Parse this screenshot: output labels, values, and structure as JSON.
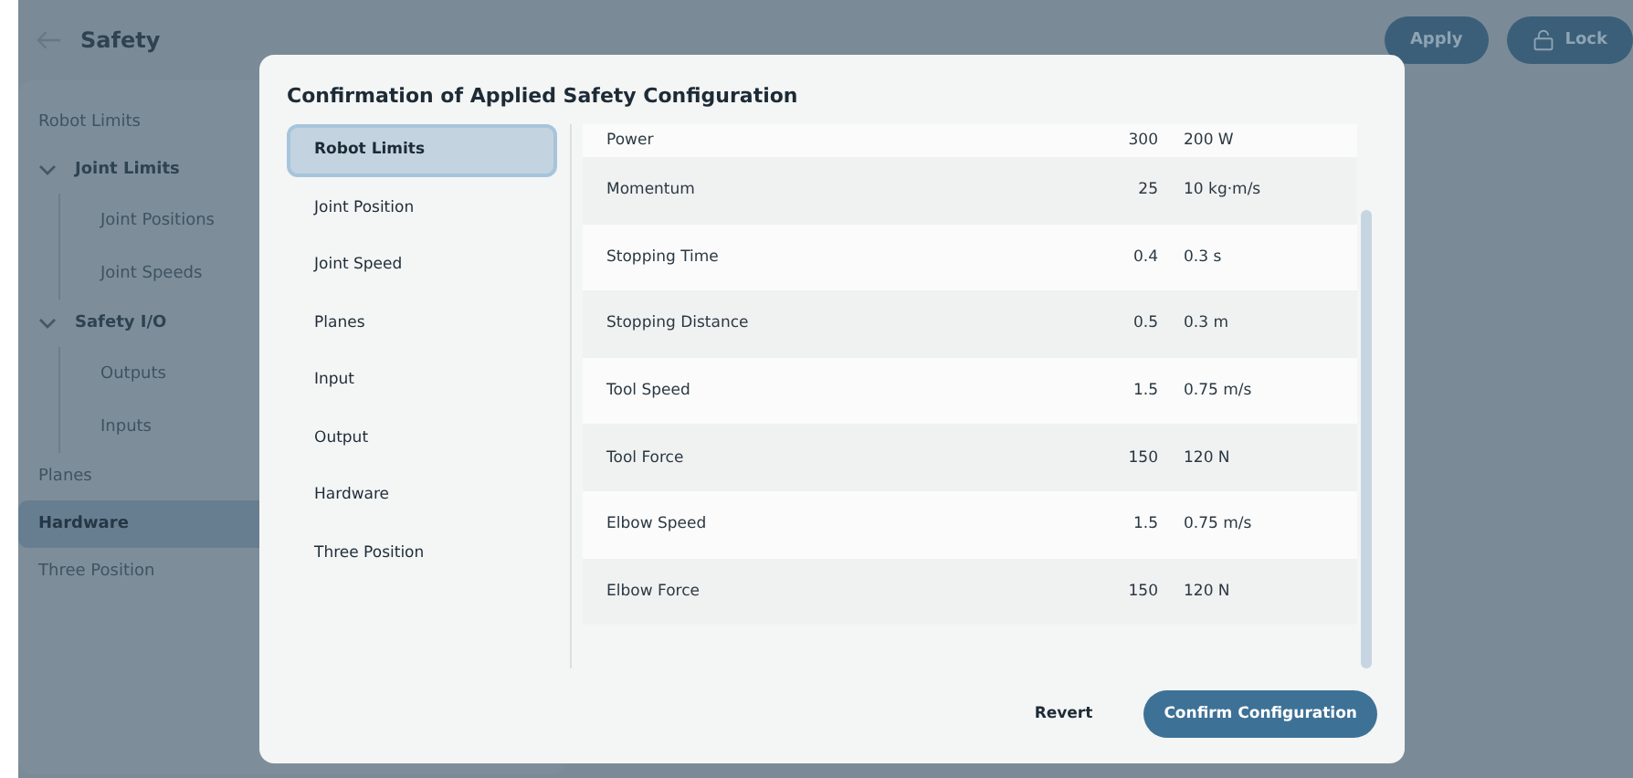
{
  "header": {
    "title": "Safety",
    "buttons": [
      {
        "label": "Apply",
        "kind": "text"
      },
      {
        "label": "Lock",
        "kind": "lock"
      }
    ]
  },
  "sidebar": {
    "items": [
      {
        "label": "Robot Limits",
        "selected": false
      },
      {
        "label": "Joint Limits",
        "selected": false,
        "expanded": true,
        "children": [
          {
            "label": "Joint Positions",
            "selected": false
          },
          {
            "label": "Joint Speeds",
            "selected": false
          }
        ]
      },
      {
        "label": "Safety I/O",
        "selected": false,
        "expanded": true,
        "children": [
          {
            "label": "Outputs",
            "selected": false
          },
          {
            "label": "Inputs",
            "selected": false
          }
        ]
      },
      {
        "label": "Planes",
        "selected": false
      },
      {
        "label": "Hardware",
        "selected": true
      },
      {
        "label": "Three Position",
        "selected": false
      }
    ]
  },
  "dialog": {
    "title": "Confirmation of Applied Safety Configuration",
    "nav": [
      {
        "label": "Robot Limits",
        "selected": true
      },
      {
        "label": "Joint Position",
        "selected": false
      },
      {
        "label": "Joint Speed",
        "selected": false
      },
      {
        "label": "Planes",
        "selected": false
      },
      {
        "label": "Input",
        "selected": false
      },
      {
        "label": "Output",
        "selected": false
      },
      {
        "label": "Hardware",
        "selected": false
      },
      {
        "label": "Three Position",
        "selected": false
      }
    ],
    "rows": [
      {
        "name": "Power",
        "current": "300",
        "applied": "200 W",
        "kind": "partial"
      },
      {
        "name": "Momentum",
        "current": "25",
        "applied": "10 kg·m/s",
        "kind": "full"
      },
      {
        "name": "Stopping Time",
        "current": "0.4",
        "applied": "0.3 s",
        "kind": "full"
      },
      {
        "name": "Stopping Distance",
        "current": "0.5",
        "applied": "0.3 m",
        "kind": "full"
      },
      {
        "name": "Tool Speed",
        "current": "1.5",
        "applied": "0.75 m/s",
        "kind": "full"
      },
      {
        "name": "Tool Force",
        "current": "150",
        "applied": "120 N",
        "kind": "full"
      },
      {
        "name": "Elbow Speed",
        "current": "1.5",
        "applied": "0.75 m/s",
        "kind": "full"
      },
      {
        "name": "Elbow Force",
        "current": "150",
        "applied": "120 N",
        "kind": "full"
      }
    ],
    "buttons": [
      {
        "label": "Revert",
        "kind": "secondary"
      },
      {
        "label": "Confirm Configuration",
        "kind": "primary"
      }
    ]
  }
}
